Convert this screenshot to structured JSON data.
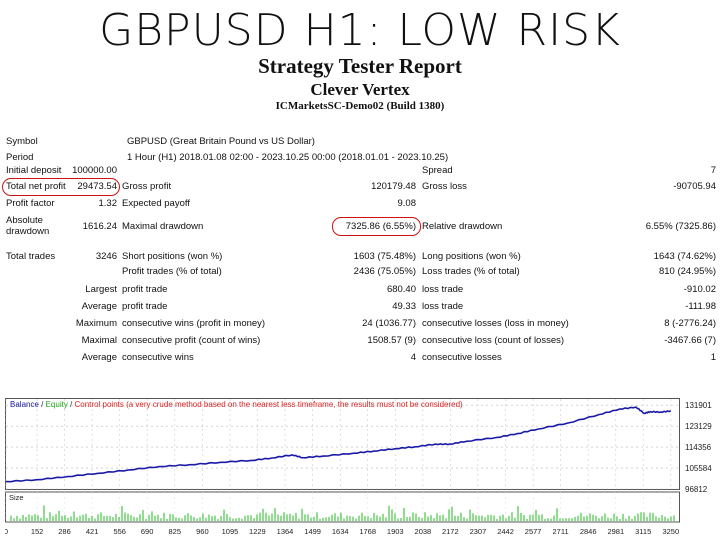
{
  "header": {
    "banner": "GBPUSD H1: LOW RISK",
    "title": "Strategy Tester Report",
    "expert": "Clever Vertex",
    "server": "ICMarketsSC-Demo02 (Build 1380)"
  },
  "report": {
    "symbol_label": "Symbol",
    "symbol_value": "GBPUSD (Great Britain Pound vs US Dollar)",
    "period_label": "Period",
    "period_value": "1 Hour (H1) 2018.01.08 02:00 - 2023.10.25 00:00 (2018.01.01 - 2023.10.25)",
    "initial_deposit_label": "Initial deposit",
    "initial_deposit_value": "100000.00",
    "spread_label": "Spread",
    "spread_value": "7",
    "total_net_profit_label": "Total net profit",
    "total_net_profit_value": "29473.54",
    "gross_profit_label": "Gross profit",
    "gross_profit_value": "120179.48",
    "gross_loss_label": "Gross loss",
    "gross_loss_value": "-90705.94",
    "profit_factor_label": "Profit factor",
    "profit_factor_value": "1.32",
    "expected_payoff_label": "Expected payoff",
    "expected_payoff_value": "9.08",
    "absolute_drawdown_label_1": "Absolute",
    "absolute_drawdown_label_2": "drawdown",
    "absolute_drawdown_value": "1616.24",
    "maximal_drawdown_label": "Maximal drawdown",
    "maximal_drawdown_value": "7325.86 (6.55%)",
    "relative_drawdown_label": "Relative drawdown",
    "relative_drawdown_value": "6.55% (7325.86)",
    "total_trades_label": "Total trades",
    "total_trades_value": "3246",
    "short_positions_label": "Short positions (won %)",
    "short_positions_value": "1603 (75.48%)",
    "long_positions_label": "Long positions (won %)",
    "long_positions_value": "1643 (74.62%)",
    "profit_trades_label": "Profit trades (% of total)",
    "profit_trades_value": "2436 (75.05%)",
    "loss_trades_label": "Loss trades (% of total)",
    "loss_trades_value": "810 (24.95%)",
    "largest_label": "Largest",
    "largest_profit_label": "profit trade",
    "largest_profit_value": "680.40",
    "largest_loss_label": "loss trade",
    "largest_loss_value": "-910.02",
    "average_label": "Average",
    "average_profit_label": "profit trade",
    "average_profit_value": "49.33",
    "average_loss_label": "loss trade",
    "average_loss_value": "-111.98",
    "maximum_label": "Maximum",
    "max_consec_wins_label": "consecutive wins (profit in money)",
    "max_consec_wins_value": "24 (1036.77)",
    "max_consec_losses_label": "consecutive losses (loss in money)",
    "max_consec_losses_value": "8 (-2776.24)",
    "maximal_label": "Maximal",
    "maximal_consec_profit_label": "consecutive profit (count of wins)",
    "maximal_consec_profit_value": "1508.57 (9)",
    "maximal_consec_loss_label": "consecutive loss (count of losses)",
    "maximal_consec_loss_value": "-3467.66 (7)",
    "average2_label": "Average",
    "avg_consec_wins_label": "consecutive wins",
    "avg_consec_wins_value": "4",
    "avg_consec_losses_label": "consecutive losses",
    "avg_consec_losses_value": "1"
  },
  "legend": {
    "balance": "Balance",
    "sep1": " / ",
    "equity": "Equity",
    "sep2": " / ",
    "rest": "Control points (a very crude method based on the nearest less timeframe, the results must not be considered)"
  },
  "colors": {
    "balance": "#1a1aa8",
    "equity": "#22aa22",
    "control": "#dd2222",
    "highlight": "#cc1111",
    "size_bars": "#22bb22"
  },
  "chart_data": {
    "type": "line",
    "series": [
      {
        "name": "Balance",
        "x": [
          0,
          150,
          300,
          450,
          600,
          750,
          900,
          1050,
          1200,
          1300,
          1400,
          1450,
          1550,
          1700,
          1800,
          1903,
          2000,
          2100,
          2172,
          2250,
          2400,
          2500,
          2600,
          2750,
          2900,
          3000,
          3080,
          3120,
          3150,
          3200,
          3250
        ],
        "values": [
          99900,
          100700,
          102000,
          103400,
          104800,
          106200,
          107000,
          108000,
          108800,
          109800,
          111100,
          109900,
          110600,
          111800,
          112700,
          113700,
          114500,
          115600,
          115600,
          116800,
          118400,
          120000,
          121900,
          124500,
          128000,
          130300,
          131100,
          128500,
          129200,
          129000,
          129500
        ]
      }
    ],
    "ytick_labels": [
      "131901",
      "123129",
      "114356",
      "105584",
      "96812"
    ],
    "yticks": [
      131901,
      123129,
      114356,
      105584,
      96812
    ],
    "ylim": [
      96812,
      134500
    ],
    "xticks": [
      0,
      152,
      286,
      421,
      556,
      690,
      825,
      960,
      1095,
      1229,
      1364,
      1499,
      1634,
      1768,
      1903,
      2038,
      2172,
      2307,
      2442,
      2577,
      2711,
      2846,
      2981,
      3115,
      3250
    ],
    "xlim": [
      0,
      3290
    ],
    "size_label": "Size",
    "grid": true
  }
}
